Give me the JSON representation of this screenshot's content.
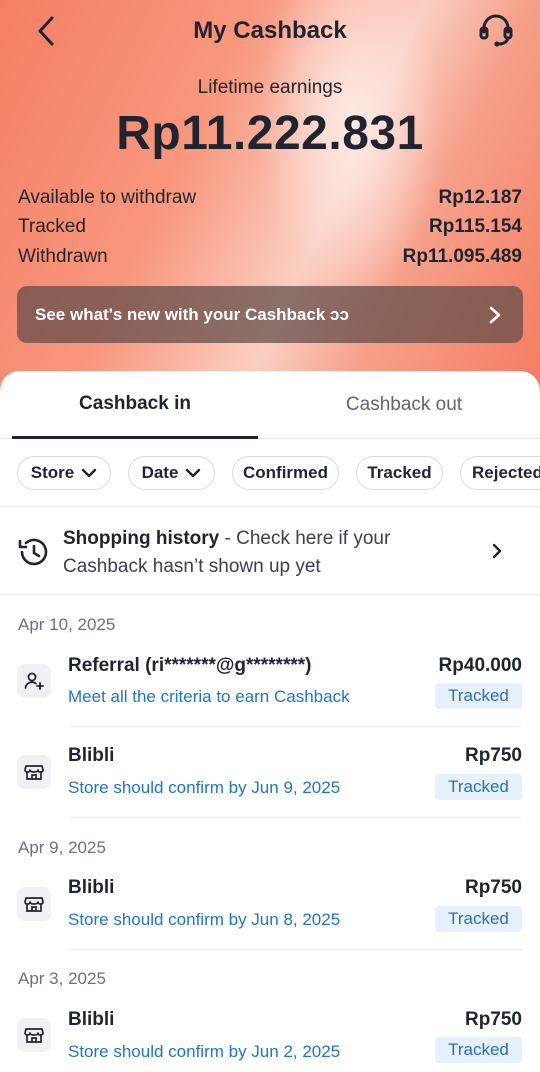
{
  "header": {
    "title": "My Cashback"
  },
  "summary": {
    "lifetime_label": "Lifetime earnings",
    "lifetime_value": "Rp11.222.831",
    "stats": [
      {
        "label": "Available to withdraw",
        "value": "Rp12.187"
      },
      {
        "label": "Tracked",
        "value": "Rp115.154"
      },
      {
        "label": "Withdrawn",
        "value": "Rp11.095.489"
      }
    ]
  },
  "promo": {
    "text": "See what's new with your Cashback ɔɔ"
  },
  "tabs": [
    {
      "label": "Cashback in",
      "active": true
    },
    {
      "label": "Cashback out",
      "active": false
    }
  ],
  "filters": [
    {
      "label": "Store",
      "dropdown": true
    },
    {
      "label": "Date",
      "dropdown": true
    },
    {
      "label": "Confirmed",
      "dropdown": false
    },
    {
      "label": "Tracked",
      "dropdown": false
    },
    {
      "label": "Rejected",
      "dropdown": false
    }
  ],
  "history": {
    "title": "Shopping history",
    "description": " - Check here if your Cashback hasn’t shown up yet"
  },
  "groups": [
    {
      "date": "Apr 10, 2025",
      "items": [
        {
          "icon": "referral-icon",
          "title": "Referral (ri*******@g********)",
          "subtitle": "Meet all the criteria to earn Cashback",
          "amount": "Rp40.000",
          "status": "Tracked"
        },
        {
          "icon": "store-icon",
          "title": "Blibli",
          "subtitle": "Store should confirm by Jun 9, 2025",
          "amount": "Rp750",
          "status": "Tracked"
        }
      ]
    },
    {
      "date": "Apr 9, 2025",
      "items": [
        {
          "icon": "store-icon",
          "title": "Blibli",
          "subtitle": "Store should confirm by Jun 8, 2025",
          "amount": "Rp750",
          "status": "Tracked"
        }
      ]
    },
    {
      "date": "Apr 3, 2025",
      "items": [
        {
          "icon": "store-icon",
          "title": "Blibli",
          "subtitle": "Store should confirm by Jun 2, 2025",
          "amount": "Rp750",
          "status": "Tracked"
        }
      ]
    }
  ],
  "colors": {
    "accent_blue": "#1f74c8",
    "badge_bg": "#e7f1fb",
    "hero_coral": "#f47f64",
    "text_dark": "#1f2430"
  }
}
